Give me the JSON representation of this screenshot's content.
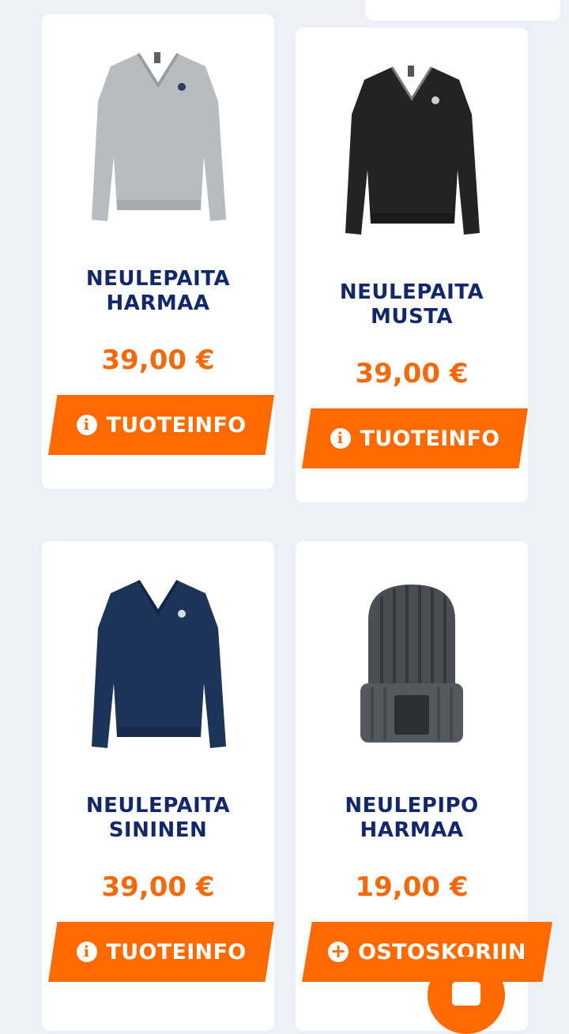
{
  "products": [
    {
      "name_line1": "NEULEPAITA",
      "name_line2": "HARMAA",
      "price": "39,00 €",
      "button_label": "TUOTEINFO",
      "button_icon": "info-icon",
      "image": "grey-v-neck-sweater"
    },
    {
      "name_line1": "NEULEPAITA",
      "name_line2": "MUSTA",
      "price": "39,00 €",
      "button_label": "TUOTEINFO",
      "button_icon": "info-icon",
      "image": "black-v-neck-sweater"
    },
    {
      "name_line1": "NEULEPAITA",
      "name_line2": "SININEN",
      "price": "39,00 €",
      "button_label": "TUOTEINFO",
      "button_icon": "info-icon",
      "image": "navy-v-neck-sweater"
    },
    {
      "name_line1": "NEULEPIPO",
      "name_line2": "HARMAA",
      "price": "19,00 €",
      "button_label": "OSTOSKORIIN",
      "button_icon": "plus-icon",
      "image": "grey-knit-beanie"
    }
  ],
  "icons": {
    "info": "i",
    "plus": "+"
  },
  "colors": {
    "accent": "#ff6a00",
    "price": "#f26a0e",
    "title": "#13286b",
    "background": "#eef0f7",
    "card": "#ffffff"
  }
}
